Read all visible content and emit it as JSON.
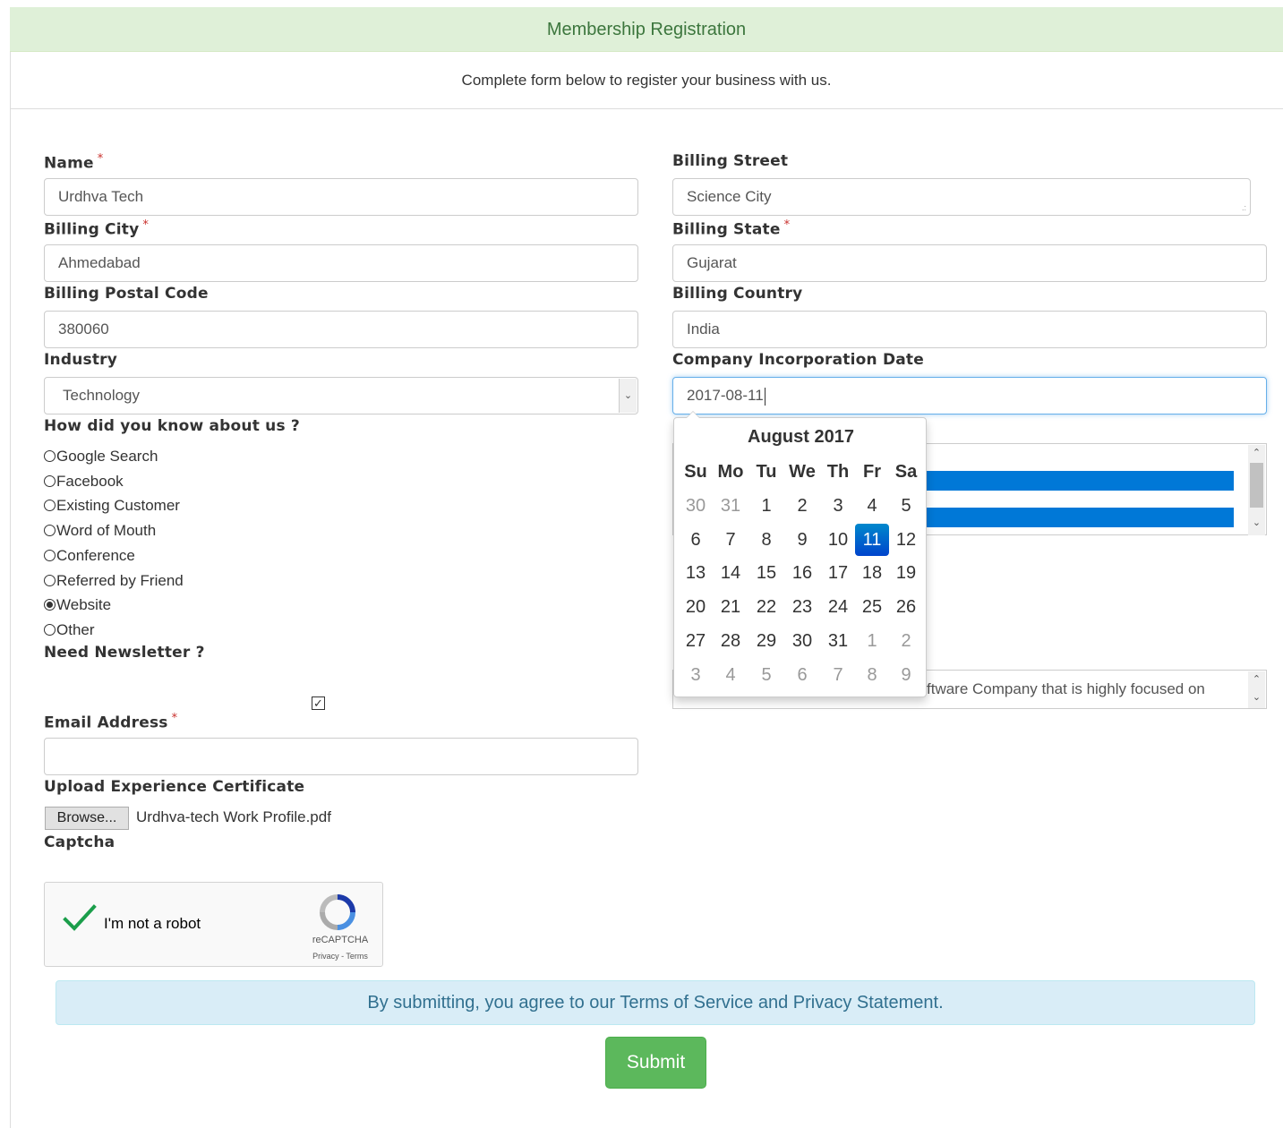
{
  "header": {
    "title": "Membership Registration",
    "subtitle": "Complete form below to register your business with us."
  },
  "form": {
    "name": {
      "label": "Name",
      "value": "Urdhva Tech"
    },
    "billing_street": {
      "label": "Billing Street",
      "value": "Science City"
    },
    "billing_city": {
      "label": "Billing City",
      "value": "Ahmedabad"
    },
    "billing_state": {
      "label": "Billing State",
      "value": "Gujarat"
    },
    "billing_postal_code": {
      "label": "Billing Postal Code",
      "value": "380060"
    },
    "billing_country": {
      "label": "Billing Country",
      "value": "India"
    },
    "industry": {
      "label": "Industry",
      "value": "Technology"
    },
    "incorporation_date": {
      "label": "Company Incorporation Date",
      "value": "2017-08-11"
    },
    "how_know": {
      "label": "How did you know about us ?",
      "options": [
        "Google Search",
        "Facebook",
        "Existing Customer",
        "Word of Mouth",
        "Conference",
        "Referred by Friend",
        "Website",
        "Other"
      ],
      "selected": "Website"
    },
    "newsletter": {
      "label": "Need Newsletter ?",
      "checked": true
    },
    "email": {
      "label": "Email Address",
      "value": ""
    },
    "upload": {
      "label": "Upload Experience Certificate",
      "button": "Browse...",
      "filename": "Urdhva-tech Work Profile.pdf"
    },
    "captcha": {
      "label": "Captcha",
      "text": "I'm not a robot",
      "brand": "reCAPTCHA",
      "terms": "Privacy - Terms"
    },
    "description_partial": "ftware Company that is highly focused on",
    "terms_notice": "By submitting, you agree to our Terms of Service and Privacy Statement.",
    "submit": "Submit"
  },
  "datepicker": {
    "title": "August 2017",
    "weekdays": [
      "Su",
      "Mo",
      "Tu",
      "We",
      "Th",
      "Fr",
      "Sa"
    ],
    "weeks": [
      [
        "30",
        "31",
        "1",
        "2",
        "3",
        "4",
        "5"
      ],
      [
        "6",
        "7",
        "8",
        "9",
        "10",
        "11",
        "12"
      ],
      [
        "13",
        "14",
        "15",
        "16",
        "17",
        "18",
        "19"
      ],
      [
        "20",
        "21",
        "22",
        "23",
        "24",
        "25",
        "26"
      ],
      [
        "27",
        "28",
        "29",
        "30",
        "31",
        "1",
        "2"
      ],
      [
        "3",
        "4",
        "5",
        "6",
        "7",
        "8",
        "9"
      ]
    ],
    "selected": "11",
    "colors": {
      "active_start": "#0088cc",
      "active_end": "#0044cc"
    }
  },
  "colors": {
    "heading_bg": "#dff0d8",
    "heading_text": "#3c763d",
    "alert_bg": "#d9edf7",
    "alert_text": "#31708f",
    "submit_bg": "#5cb85c",
    "required": "#c9302c",
    "listbox_selection": "#0078d7"
  }
}
